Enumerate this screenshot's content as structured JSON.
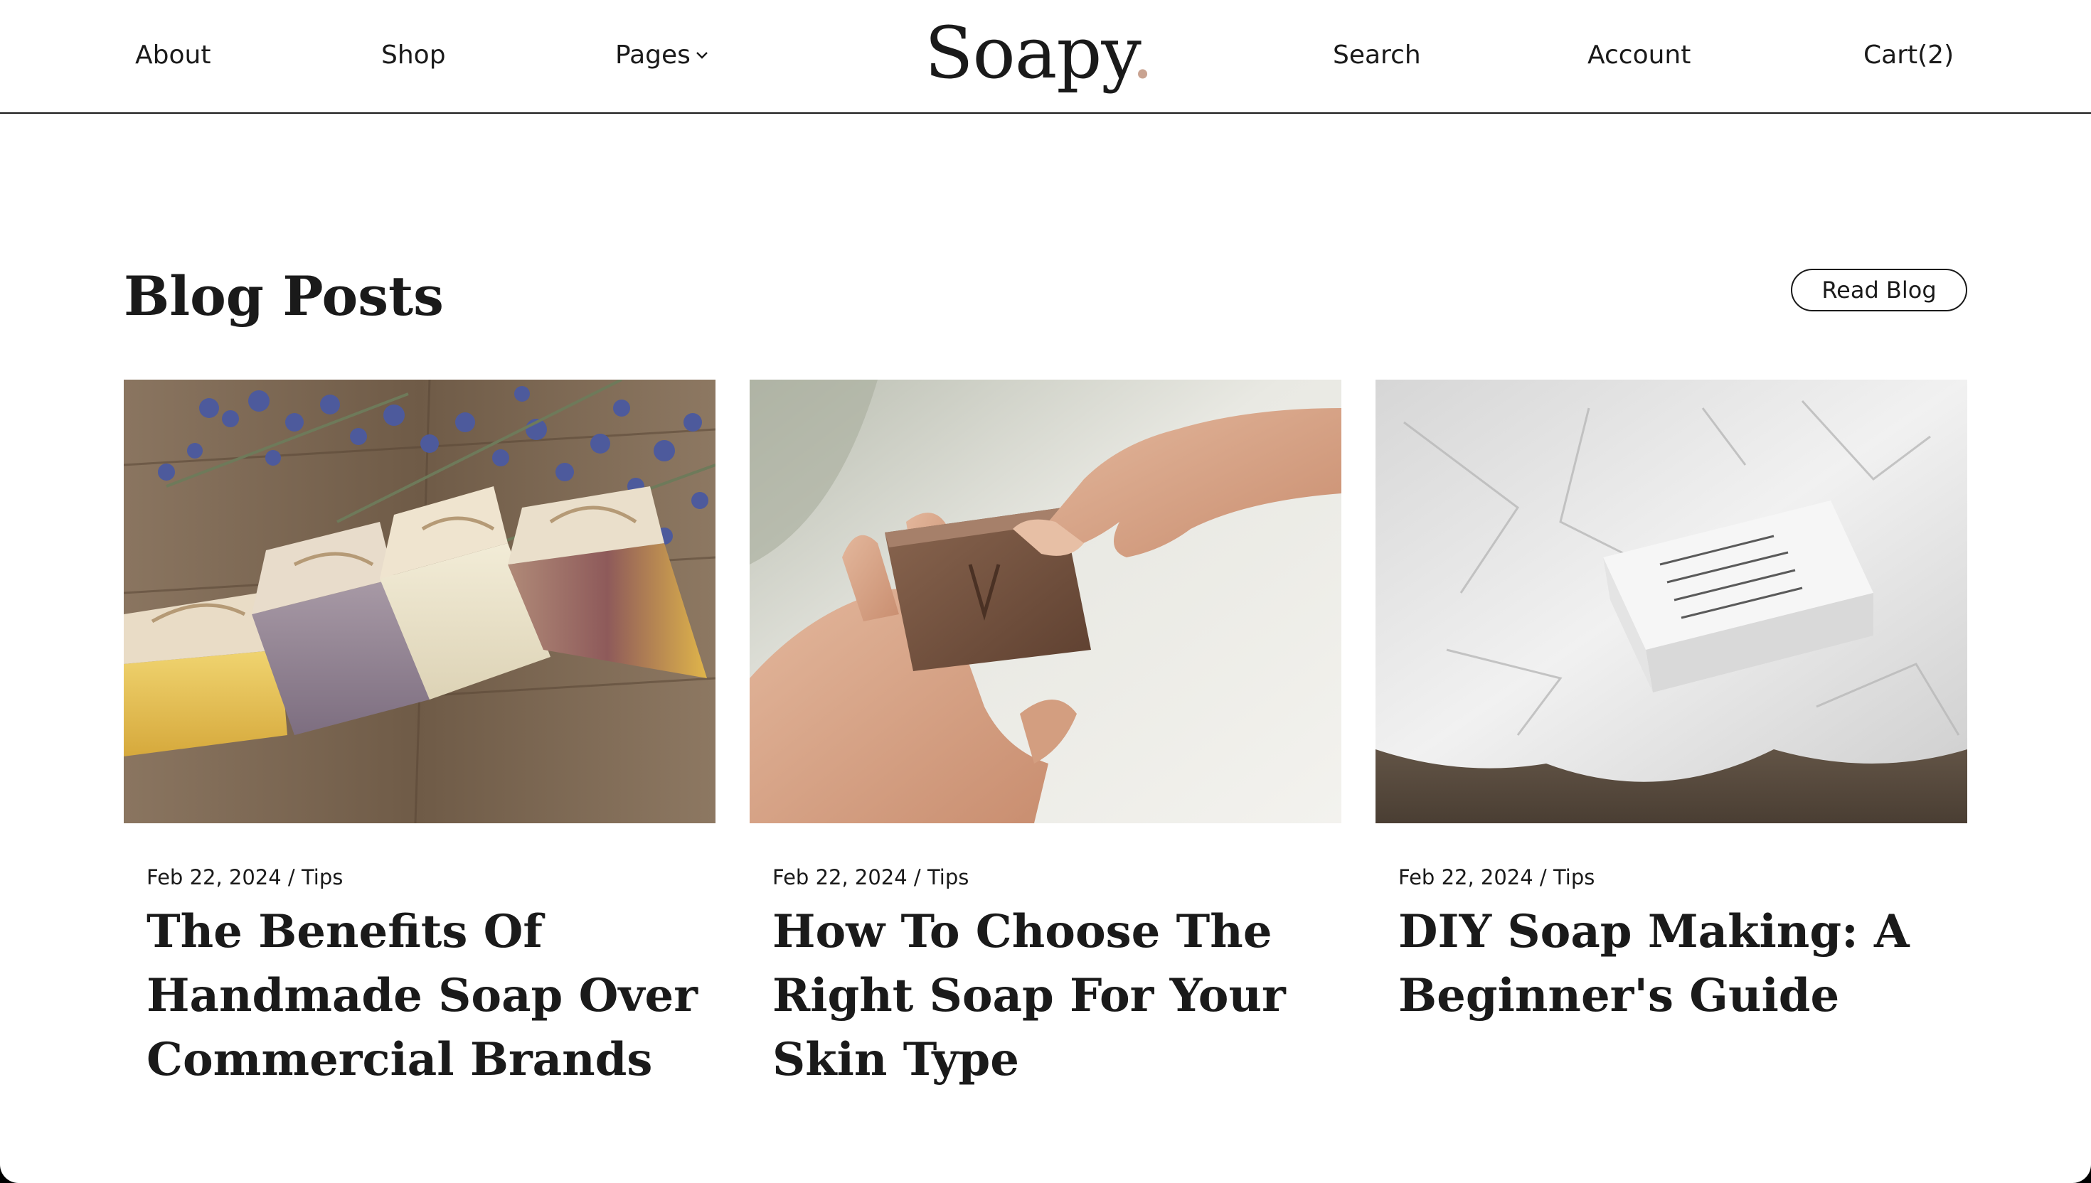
{
  "header": {
    "logo": "Soapy",
    "logo_dot": ".",
    "nav_left": [
      "About",
      "Shop",
      "Pages"
    ],
    "nav_right": [
      "Search",
      "Account",
      "Cart(2)"
    ]
  },
  "section": {
    "title": "Blog Posts",
    "read_blog_label": "Read Blog"
  },
  "posts": [
    {
      "date": "Feb 22, 2024",
      "separator": " / ",
      "category": "Tips",
      "title": "The Benefits Of Handmade Soap Over Commercial Brands"
    },
    {
      "date": "Feb 22, 2024",
      "separator": " / ",
      "category": "Tips",
      "title": "How To Choose The Right Soap For Your Skin Type"
    },
    {
      "date": "Feb 22, 2024",
      "separator": " / ",
      "category": "Tips",
      "title": "DIY Soap Making: A Beginner's Guide"
    }
  ],
  "icons": {
    "pages_dropdown": "chevron-down-icon"
  },
  "colors": {
    "text": "#1a1a1a",
    "logo_dot": "#c9a391",
    "background": "#ffffff"
  }
}
